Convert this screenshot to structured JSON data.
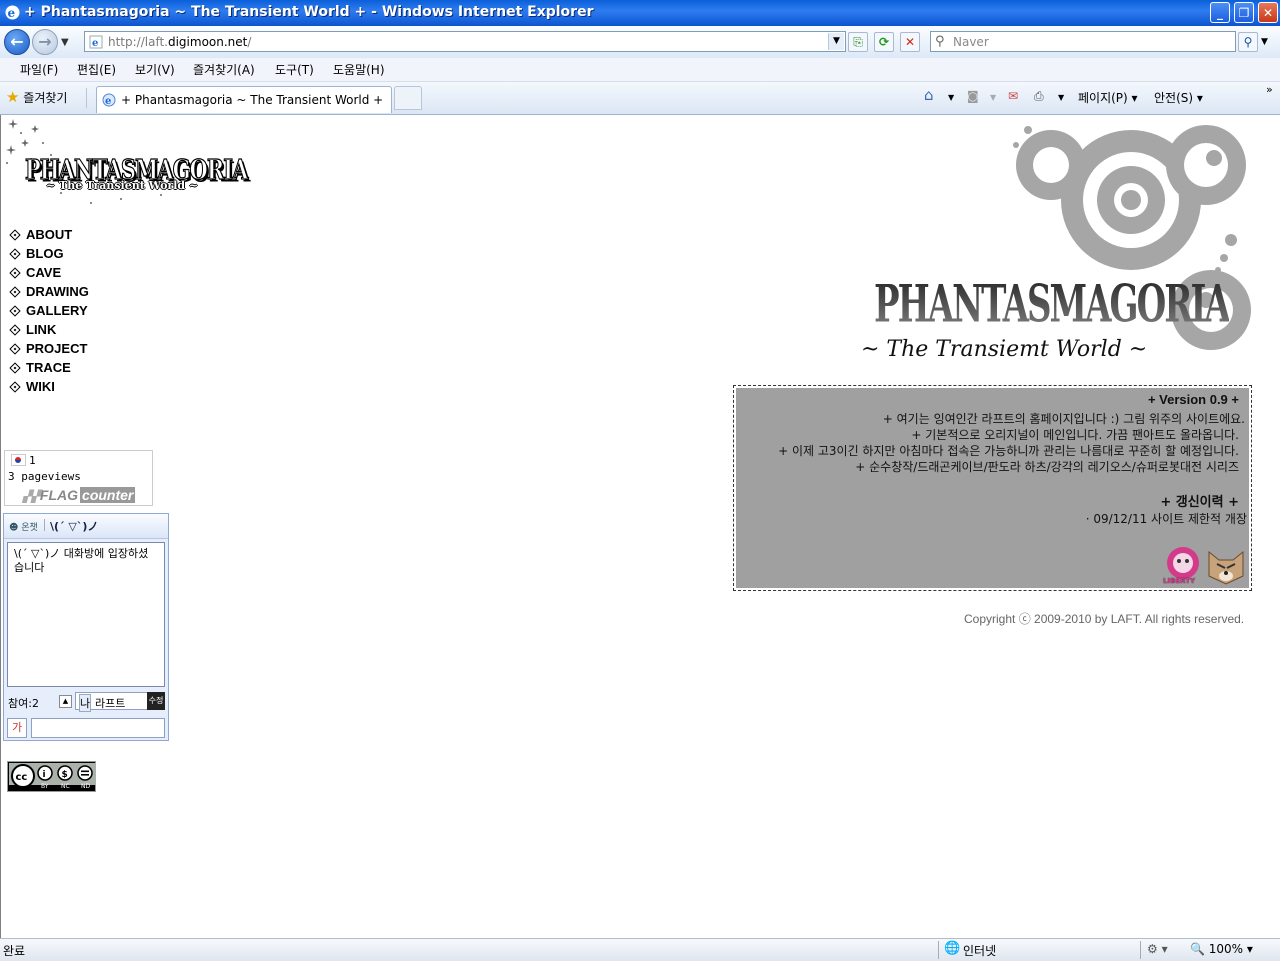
{
  "window": {
    "title": "+ Phantasmagoria ~ The Transient World + - Windows Internet Explorer"
  },
  "address": {
    "url_prefix": "http://laft.",
    "url_domain": "digimoon.net",
    "url_suffix": "/",
    "search_placeholder": "Naver"
  },
  "menu": [
    "파일(F)",
    "편집(E)",
    "보기(V)",
    "즐겨찾기(A)",
    "도구(T)",
    "도움말(H)"
  ],
  "tabs": {
    "favorites_label": "즐겨찾기",
    "active_tab_title": "+ Phantasmagoria ~ The Transient World +",
    "page_label": "페이지(P)",
    "safety_label": "안전(S)"
  },
  "logo": {
    "title": "PHANTASMAGORIA",
    "subtitle": "~ The Transient World ~"
  },
  "nav": [
    "ABOUT",
    "BLOG",
    "CAVE",
    "DRAWING",
    "GALLERY",
    "LINK",
    "PROJECT",
    "TRACE",
    "WIKI"
  ],
  "flag_counter": {
    "count": "1",
    "pageviews": "3 pageviews",
    "logo_flag": "FLAG",
    "logo_counter": "counter"
  },
  "chat": {
    "header_label": "온챗",
    "header_title": "\\(´ ▽`)ノ",
    "message": "\\(´ ▽`)ノ 대화방에 입장하셨습니다",
    "participants": "참여:2",
    "nick_prefix": "나",
    "nickname": "라프트",
    "edit_label": "수정",
    "font_button": "가",
    "input_value": ""
  },
  "banner": {
    "title": "PHANTASMAGORIA",
    "subtitle": "~ The Transiemt World ~"
  },
  "notice": {
    "version_heading": "+ Version 0.9 +",
    "lines": [
      "+ 여기는 잉여인간 라프트의 홈페이지입니다 :) 그림 위주의 사이트에요.",
      "+ 기본적으로 오리지널이 메인입니다. 가끔 팬아트도 올라옵니다.",
      "+ 이제 고3이긴 하지만 아침마다 접속은 가능하니까 관리는 나름대로 꾸준히 할 예정입니다.",
      "+ 순수창작/드래곤케이브/판도라 하츠/강각의 레기오스/슈퍼로봇대전 시리즈"
    ],
    "history_heading": "+ 갱신이력 +",
    "history_line": "· 09/12/11 사이트 제한적 개장",
    "badge_text": "LIBERTY"
  },
  "copyright": "Copyright ⓒ 2009-2010 by LAFT. All rights reserved.",
  "cc_badge": {
    "labels": [
      "BY",
      "NC",
      "ND"
    ]
  },
  "status": {
    "left": "완료",
    "zone": "인터넷",
    "zoom": "100%"
  }
}
